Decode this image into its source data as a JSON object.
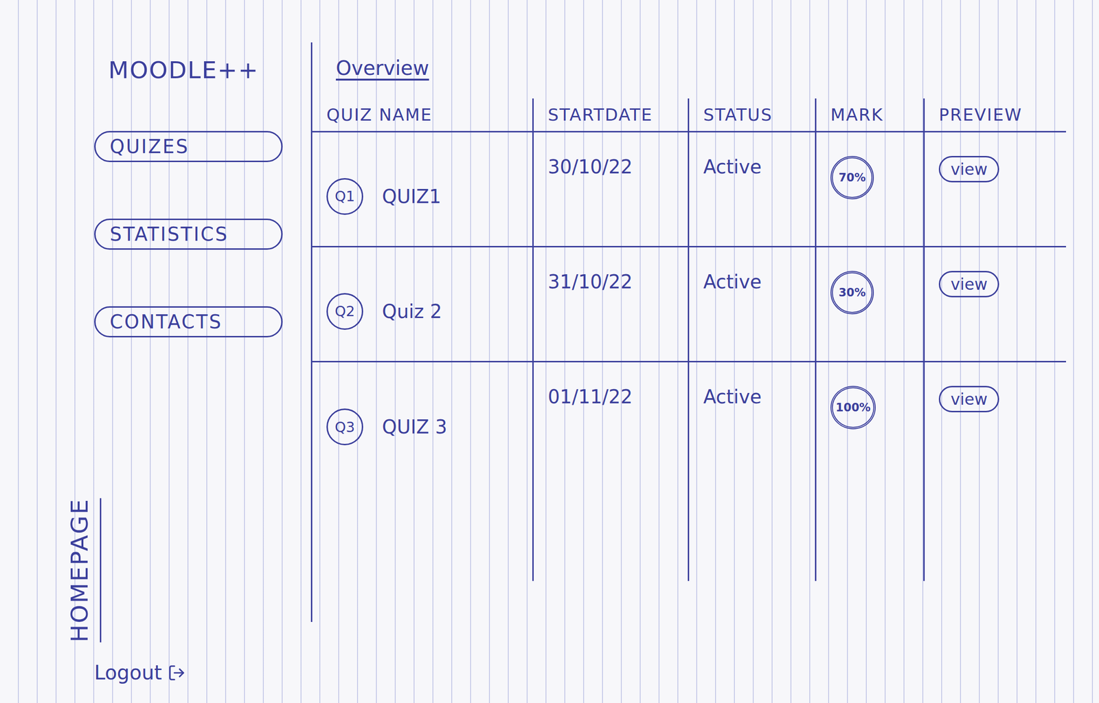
{
  "app": {
    "title": "MOODLE++"
  },
  "sidebar": {
    "items": [
      {
        "label": "QUIZES"
      },
      {
        "label": "STATISTICS"
      },
      {
        "label": "CONTACTS"
      }
    ],
    "page_label": "HOMEPAGE",
    "logout": {
      "label": "Logout"
    }
  },
  "overview": {
    "title": "Overview"
  },
  "table": {
    "columns": [
      "QUIZ NAME",
      "STARTDATE",
      "STATUS",
      "MARK",
      "PREVIEW"
    ],
    "rows": [
      {
        "badge": "Q1",
        "name": "QUIZ1",
        "start_date": "30/10/22",
        "status": "Active",
        "mark": "70%",
        "preview": "view"
      },
      {
        "badge": "Q2",
        "name": "Quiz 2",
        "start_date": "31/10/22",
        "status": "Active",
        "mark": "30%",
        "preview": "view"
      },
      {
        "badge": "Q3",
        "name": "QUIZ 3",
        "start_date": "01/11/22",
        "status": "Active",
        "mark": "100%",
        "preview": "view"
      }
    ]
  }
}
